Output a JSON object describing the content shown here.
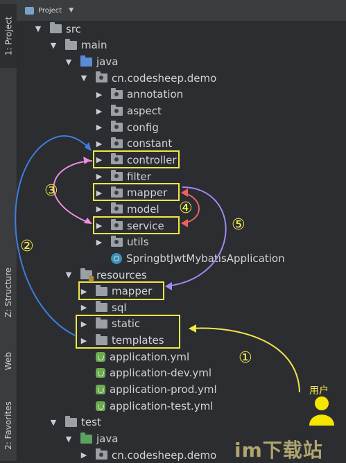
{
  "sidebar": {
    "project_tab": "1: Project",
    "structure_tab": "Z: Structure",
    "web_tab": "Web",
    "favorites_tab": "2: Favorites"
  },
  "header": {
    "title": "Project",
    "dropdown_icon": "chevron-down-icon"
  },
  "tree": [
    {
      "label": "src",
      "depth": 0,
      "expanded": true,
      "icon": "folder"
    },
    {
      "label": "main",
      "depth": 1,
      "expanded": true,
      "icon": "folder"
    },
    {
      "label": "java",
      "depth": 2,
      "expanded": true,
      "icon": "source-folder"
    },
    {
      "label": "cn.codesheep.demo",
      "depth": 3,
      "expanded": true,
      "icon": "package"
    },
    {
      "label": "annotation",
      "depth": 4,
      "expanded": false,
      "icon": "package"
    },
    {
      "label": "aspect",
      "depth": 4,
      "expanded": false,
      "icon": "package"
    },
    {
      "label": "config",
      "depth": 4,
      "expanded": false,
      "icon": "package"
    },
    {
      "label": "constant",
      "depth": 4,
      "expanded": false,
      "icon": "package"
    },
    {
      "label": "controller",
      "depth": 4,
      "expanded": false,
      "icon": "package"
    },
    {
      "label": "filter",
      "depth": 4,
      "expanded": false,
      "icon": "package"
    },
    {
      "label": "mapper",
      "depth": 4,
      "expanded": false,
      "icon": "package"
    },
    {
      "label": "model",
      "depth": 4,
      "expanded": false,
      "icon": "package"
    },
    {
      "label": "service",
      "depth": 4,
      "expanded": false,
      "icon": "package"
    },
    {
      "label": "utils",
      "depth": 4,
      "expanded": false,
      "icon": "package"
    },
    {
      "label": "SpringbtJwtMybatisApplication",
      "depth": 4,
      "icon": "spring-app"
    },
    {
      "label": "resources",
      "depth": 2,
      "expanded": true,
      "icon": "resources-folder"
    },
    {
      "label": "mapper",
      "depth": 3,
      "expanded": false,
      "icon": "folder"
    },
    {
      "label": "sql",
      "depth": 3,
      "expanded": false,
      "icon": "folder"
    },
    {
      "label": "static",
      "depth": 3,
      "expanded": false,
      "icon": "folder"
    },
    {
      "label": "templates",
      "depth": 3,
      "expanded": false,
      "icon": "folder"
    },
    {
      "label": "application.yml",
      "depth": 3,
      "icon": "spring-config"
    },
    {
      "label": "application-dev.yml",
      "depth": 3,
      "icon": "spring-config"
    },
    {
      "label": "application-prod.yml",
      "depth": 3,
      "icon": "spring-config"
    },
    {
      "label": "application-test.yml",
      "depth": 3,
      "icon": "spring-config"
    },
    {
      "label": "test",
      "depth": 1,
      "expanded": true,
      "icon": "folder"
    },
    {
      "label": "java",
      "depth": 2,
      "expanded": true,
      "icon": "test-folder"
    },
    {
      "label": "cn.codesheep.demo",
      "depth": 3,
      "expanded": false,
      "icon": "package"
    }
  ],
  "annotations": {
    "circled_1": "①",
    "circled_2": "②",
    "circled_3": "③",
    "circled_4": "④",
    "circled_5": "⑤",
    "user_label": "用户",
    "watermark": "im下载站",
    "highlight_color": "#f2e64a"
  }
}
